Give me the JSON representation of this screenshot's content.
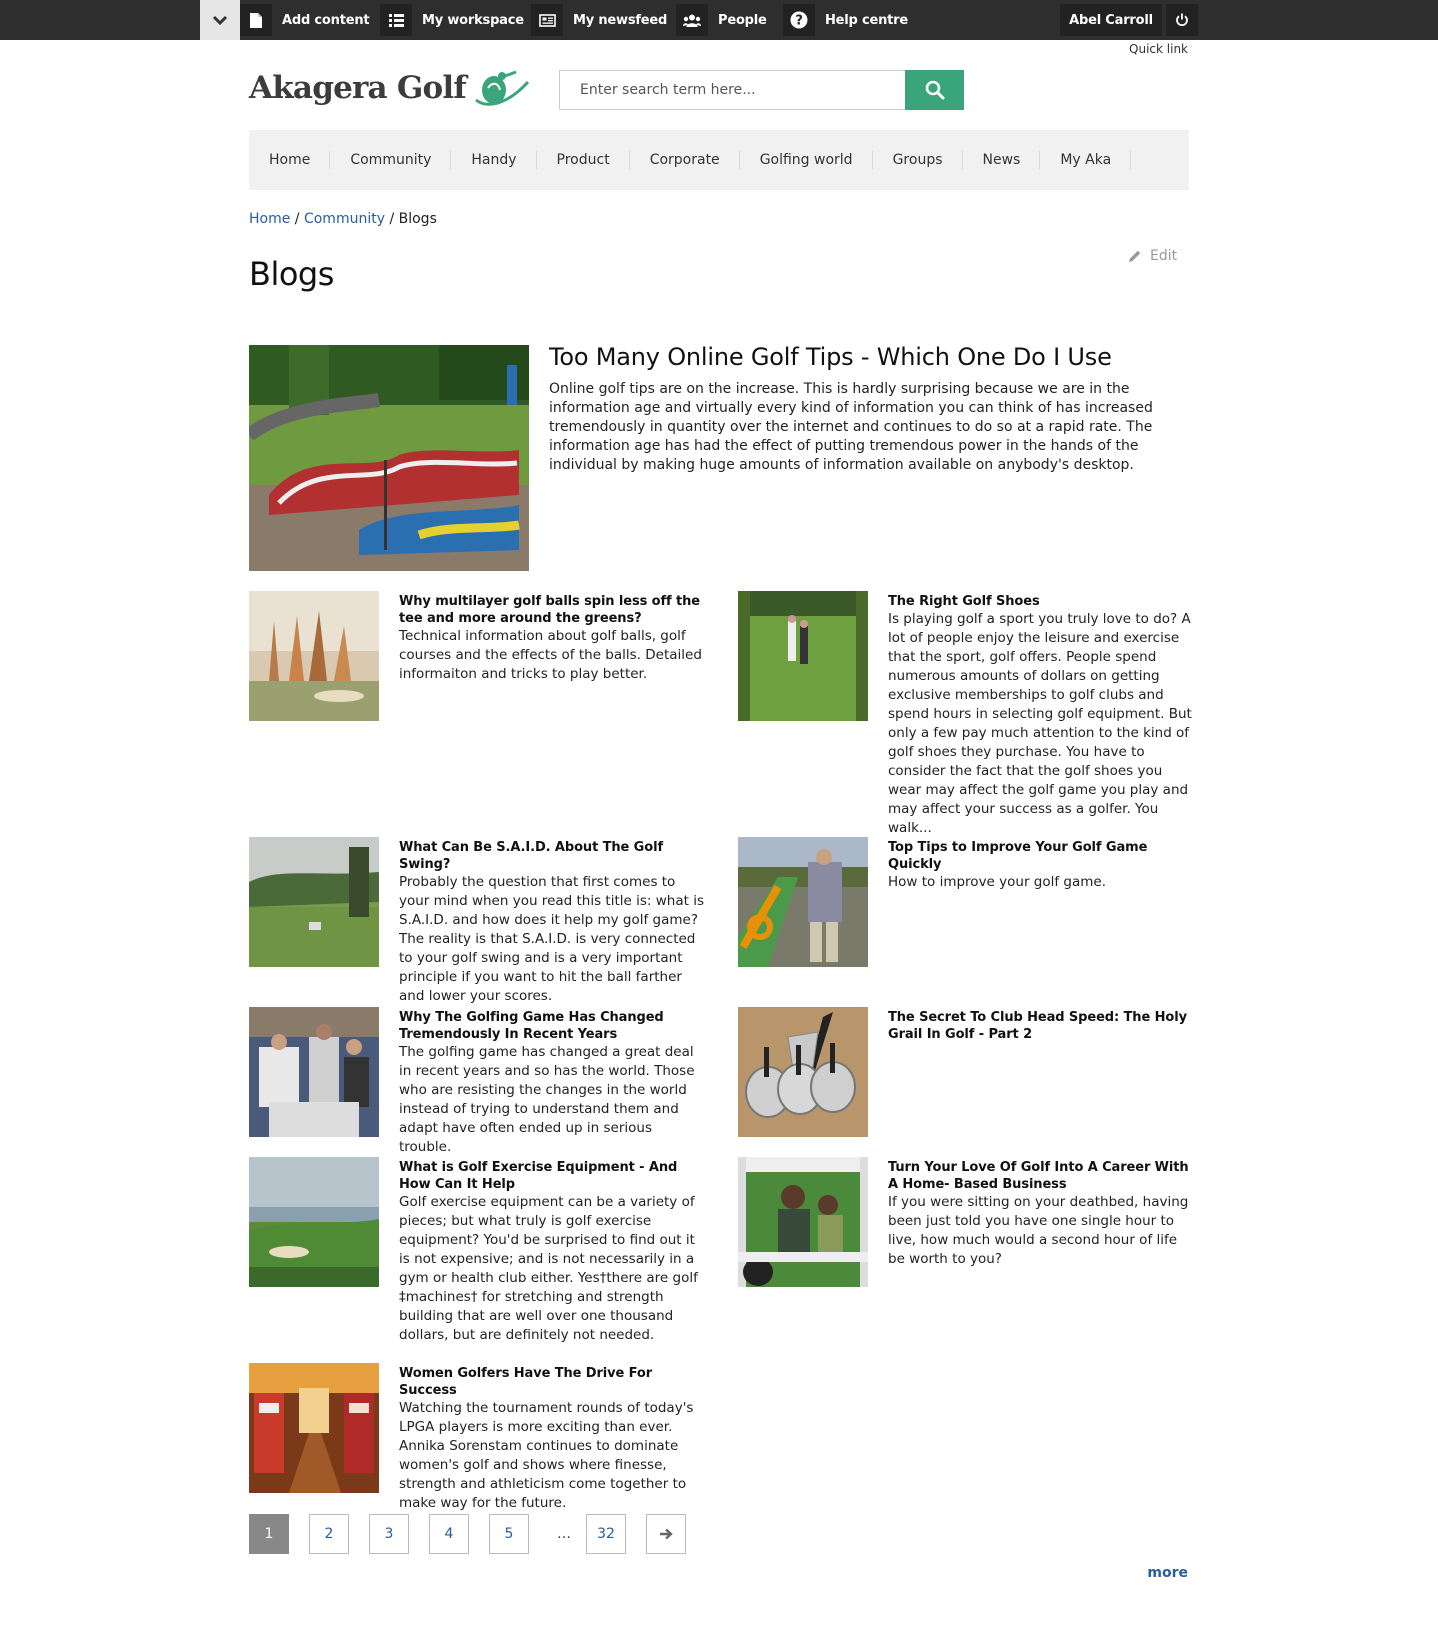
{
  "topbar": {
    "items": [
      {
        "label": "Add content",
        "icon": "file-icon"
      },
      {
        "label": "My workspace",
        "icon": "list-icon"
      },
      {
        "label": "My newsfeed",
        "icon": "newspaper-icon"
      },
      {
        "label": "People",
        "icon": "users-icon"
      },
      {
        "label": "Help centre",
        "icon": "question-icon"
      }
    ],
    "user": "Abel Carroll",
    "quick_link": "Quick link"
  },
  "site": {
    "name": "Akagera Golf"
  },
  "search": {
    "placeholder": "Enter search term here..."
  },
  "nav": [
    "Home",
    "Community",
    "Handy",
    "Product",
    "Corporate",
    "Golfing world",
    "Groups",
    "News",
    "My Aka"
  ],
  "breadcrumb": {
    "home": "Home",
    "sep1": " / ",
    "community": "Community",
    "sep2": " / ",
    "current": "Blogs"
  },
  "page": {
    "title": "Blogs",
    "edit_label": "Edit"
  },
  "featured": {
    "title": "Too Many Online Golf Tips - Which One Do I Use",
    "text": "Online golf tips are on the increase. This is hardly surprising because we are in the information age and virtually every kind of information you can think of has increased tremendously in quantity over the internet and continues to do so at a rapid rate. The information age has had the effect of putting tremendous power in the hands of the individual by making huge amounts of information available on anybody's desktop."
  },
  "posts": [
    {
      "title": "Why multilayer golf balls spin less off the tee and more around the greens?",
      "text": "Technical information about golf balls, golf courses and the effects of the balls. Detailed informaiton and tricks to play better."
    },
    {
      "title": "The Right Golf Shoes",
      "text": "Is playing golf a sport you truly love to do? A lot of people enjoy the leisure and exercise that the sport, golf offers. People spend numerous amounts of dollars on getting exclusive memberships to golf clubs and spend hours in selecting golf equipment. But only a few pay much attention to the kind of golf shoes they purchase. You have to consider the fact that the golf shoes you wear may affect the golf game you play and may affect your success as a golfer. You walk..."
    },
    {
      "title": "What Can Be S.A.I.D. About The Golf Swing?",
      "text": "Probably the question that first comes to your mind when you read this title is: what is S.A.I.D. and how does it help my golf game? The reality is that S.A.I.D. is very connected to your golf swing and is a very important principle if you want to hit the ball farther and lower your scores."
    },
    {
      "title": "Top Tips to Improve Your Golf Game Quickly",
      "text": "How to improve your golf game."
    },
    {
      "title": "Why The Golfing Game Has Changed Tremendously In Recent Years",
      "text": "The golfing game has changed a great deal in recent years and so has the world. Those who are resisting the changes in the world instead of trying to understand them and adapt have often ended up in serious trouble."
    },
    {
      "title": "The Secret To Club Head Speed: The Holy Grail In Golf - Part 2",
      "text": ""
    },
    {
      "title": "What is Golf Exercise Equipment - And How Can It Help",
      "text": "Golf exercise equipment can be a variety of pieces; but what truly is golf exercise equipment? You'd be surprised to find out it is not expensive; and is not necessarily in a gym or health club either. Yes†there are golf ‡machines† for stretching and strength building that are well over one thousand dollars, but are definitely not needed."
    },
    {
      "title": "Turn Your Love Of Golf Into A Career With A Home- Based Business",
      "text": "If you were sitting on your deathbed, having been just told you have one single hour to live, how much would a second hour of life be worth to you?"
    },
    {
      "title": "Women Golfers Have The Drive For Success",
      "text": "Watching the tournament rounds of today's LPGA players is more exciting than ever. Annika Sorenstam continues to dominate women's golf and shows where finesse, strength and athleticism come together to make way for the future."
    }
  ],
  "pager": {
    "pages": [
      "1",
      "2",
      "3",
      "4",
      "5"
    ],
    "ellipsis": "…",
    "last": "32",
    "next_icon": "arrow-right-icon"
  },
  "more_label": "more",
  "colors": {
    "topbar": "#2e2e2e",
    "accent": "#3aa57a",
    "link": "#2a5d9f"
  }
}
